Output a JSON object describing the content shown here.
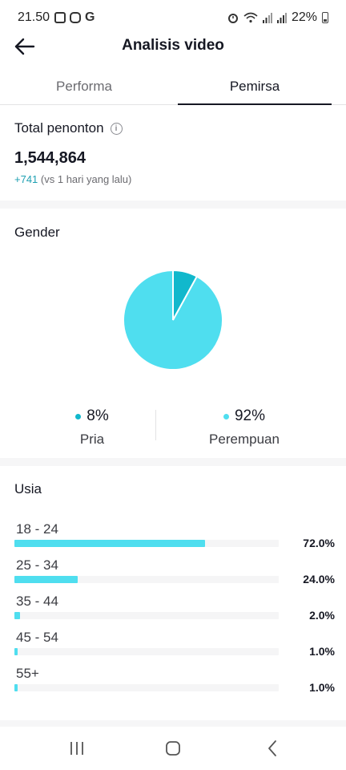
{
  "status_bar": {
    "time": "21.50",
    "battery": "22%",
    "icons_left": [
      "gallery-icon",
      "instagram-icon",
      "google-icon"
    ],
    "icons_right": [
      "alarm-icon",
      "wifi-icon",
      "signal-icon",
      "signal-icon",
      "battery-icon"
    ]
  },
  "header": {
    "title": "Analisis video",
    "back_icon": "arrow-left-icon"
  },
  "tabs": [
    {
      "label": "Performa",
      "active": false
    },
    {
      "label": "Pemirsa",
      "active": true
    }
  ],
  "total": {
    "label": "Total penonton",
    "value": "1,544,864",
    "delta": "+741",
    "delta_note": "(vs 1 hari yang lalu)"
  },
  "gender": {
    "title": "Gender",
    "items": [
      {
        "pct": "8%",
        "label": "Pria",
        "color": "#11b8cc",
        "value": 8
      },
      {
        "pct": "92%",
        "label": "Perempuan",
        "color": "#4fdeef",
        "value": 92
      }
    ]
  },
  "age": {
    "title": "Usia",
    "bar_color": "#4fdeef",
    "rows": [
      {
        "label": "18 - 24",
        "pct": "72.0%",
        "value": 72.0
      },
      {
        "label": "25 - 34",
        "pct": "24.0%",
        "value": 24.0
      },
      {
        "label": "35 - 44",
        "pct": "2.0%",
        "value": 2.0
      },
      {
        "label": "45 - 54",
        "pct": "1.0%",
        "value": 1.0
      },
      {
        "label": "55+",
        "pct": "1.0%",
        "value": 1.0
      }
    ]
  },
  "nav": {
    "icons": [
      "recent-apps-icon",
      "home-icon",
      "back-icon"
    ]
  }
}
